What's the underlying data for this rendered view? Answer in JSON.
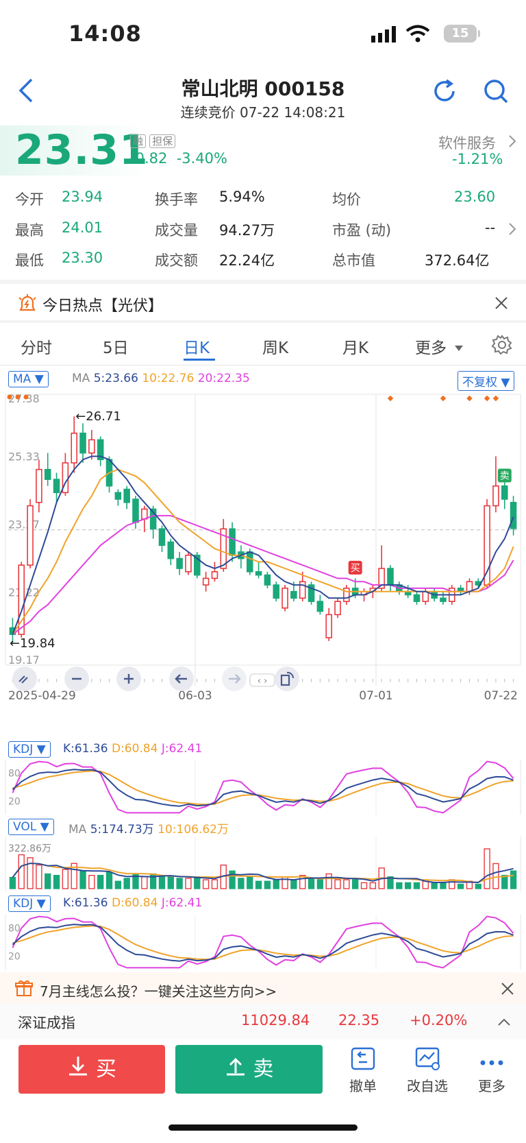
{
  "status": {
    "time": "14:08",
    "battery": "15"
  },
  "header": {
    "title": "常山北明 000158",
    "subtitle": "连续竞价 07-22 14:08:21"
  },
  "quote": {
    "price": "23.31",
    "tag_margin": "融",
    "tag_collateral": "担保",
    "change": "-0.82",
    "change_pct": "-3.40%",
    "sector_name": "软件服务",
    "sector_pct": "-1.21%"
  },
  "stats": {
    "open_label": "今开",
    "open": "23.94",
    "high_label": "最高",
    "high": "24.01",
    "low_label": "最低",
    "low": "23.30",
    "turnover_label": "换手率",
    "turnover": "5.94%",
    "volume_label": "成交量",
    "volume": "94.27万",
    "amount_label": "成交额",
    "amount": "22.24亿",
    "avg_label": "均价",
    "avg": "23.60",
    "pe_label": "市盈 (动)",
    "pe": "--",
    "mcap_label": "总市值",
    "mcap": "372.64亿"
  },
  "hot": {
    "text": "今日热点【光伏】"
  },
  "tabs": [
    "分时",
    "5日",
    "日K",
    "周K",
    "月K",
    "更多"
  ],
  "active_tab": "日K",
  "ma_bar": {
    "selector": "MA",
    "label": "MA",
    "ma5": "5:23.66",
    "ma10": "10:22.76",
    "ma20": "20:22.35",
    "adjust": "不复权"
  },
  "chart_data": {
    "type": "candlestick",
    "y_ticks": [
      "27.38",
      "25.33",
      "23.27",
      "21.22",
      "19.17"
    ],
    "x_ticks": [
      "2025-04-29",
      "06-03",
      "07-01",
      "07-22"
    ],
    "annotations": {
      "high": "26.71",
      "low": "19.84",
      "buy": "买",
      "sell": "卖"
    },
    "candles": [
      [
        20.3,
        20.6,
        19.84,
        20.1
      ],
      [
        20.1,
        22.3,
        20.0,
        22.2
      ],
      [
        22.2,
        24.2,
        22.1,
        24.0
      ],
      [
        24.1,
        25.4,
        23.8,
        25.1
      ],
      [
        25.1,
        25.6,
        24.6,
        24.8
      ],
      [
        24.8,
        25.0,
        24.1,
        24.4
      ],
      [
        24.4,
        25.6,
        24.3,
        25.3
      ],
      [
        25.3,
        26.71,
        25.0,
        26.2
      ],
      [
        26.2,
        26.5,
        25.3,
        25.6
      ],
      [
        25.6,
        26.3,
        25.4,
        26.0
      ],
      [
        26.0,
        26.1,
        25.2,
        25.4
      ],
      [
        25.4,
        25.5,
        24.4,
        24.6
      ],
      [
        24.4,
        24.5,
        24.0,
        24.2
      ],
      [
        24.5,
        24.6,
        23.9,
        24.1
      ],
      [
        24.2,
        24.3,
        23.3,
        23.5
      ],
      [
        23.6,
        24.0,
        23.2,
        23.9
      ],
      [
        23.9,
        24.0,
        23.0,
        23.3
      ],
      [
        23.3,
        23.4,
        22.6,
        22.8
      ],
      [
        22.9,
        23.0,
        22.2,
        22.4
      ],
      [
        22.4,
        22.6,
        21.9,
        22.1
      ],
      [
        22.0,
        22.6,
        21.9,
        22.5
      ],
      [
        22.5,
        22.6,
        21.8,
        21.9
      ],
      [
        21.6,
        22.0,
        21.4,
        21.8
      ],
      [
        21.8,
        22.3,
        21.7,
        22.0
      ],
      [
        22.1,
        23.6,
        22.0,
        23.3
      ],
      [
        23.3,
        23.5,
        22.3,
        22.5
      ],
      [
        22.6,
        22.8,
        22.1,
        22.4
      ],
      [
        22.6,
        22.7,
        21.9,
        22.0
      ],
      [
        22.0,
        22.3,
        21.8,
        21.9
      ],
      [
        21.9,
        22.0,
        21.5,
        21.6
      ],
      [
        21.6,
        21.7,
        21.1,
        21.2
      ],
      [
        20.9,
        21.6,
        20.8,
        21.5
      ],
      [
        21.4,
        21.7,
        21.1,
        21.2
      ],
      [
        21.2,
        22.0,
        21.1,
        21.7
      ],
      [
        21.6,
        21.7,
        21.0,
        21.1
      ],
      [
        21.1,
        21.3,
        20.7,
        20.8
      ],
      [
        20.0,
        20.9,
        19.9,
        20.7
      ],
      [
        20.7,
        21.2,
        20.6,
        21.1
      ],
      [
        21.1,
        21.6,
        21.0,
        21.5
      ],
      [
        21.5,
        21.8,
        21.2,
        21.3
      ],
      [
        21.3,
        21.5,
        21.1,
        21.4
      ],
      [
        21.4,
        21.6,
        21.2,
        21.5
      ],
      [
        21.5,
        22.8,
        21.4,
        22.1
      ],
      [
        22.1,
        22.2,
        21.4,
        21.6
      ],
      [
        21.6,
        21.7,
        21.3,
        21.4
      ],
      [
        21.4,
        21.6,
        21.2,
        21.3
      ],
      [
        21.3,
        21.4,
        21.0,
        21.1
      ],
      [
        21.1,
        21.5,
        21.0,
        21.4
      ],
      [
        21.4,
        21.5,
        21.1,
        21.2
      ],
      [
        21.2,
        21.4,
        21.0,
        21.1
      ],
      [
        21.1,
        21.6,
        21.0,
        21.5
      ],
      [
        21.5,
        21.6,
        21.3,
        21.4
      ],
      [
        21.4,
        21.8,
        21.3,
        21.7
      ],
      [
        21.7,
        21.8,
        21.5,
        21.6
      ],
      [
        21.6,
        24.2,
        21.5,
        24.0
      ],
      [
        24.0,
        25.5,
        23.8,
        24.6
      ],
      [
        24.6,
        24.8,
        23.9,
        24.2
      ],
      [
        24.1,
        24.3,
        23.1,
        23.31
      ]
    ],
    "ma5": [
      20.1,
      20.8,
      21.6,
      22.4,
      23.2,
      24.1,
      24.7,
      25.1,
      25.4,
      25.5,
      25.5,
      25.4,
      25.1,
      24.8,
      24.4,
      24.1,
      23.8,
      23.5,
      23.1,
      22.8,
      22.6,
      22.4,
      22.2,
      22.1,
      22.2,
      22.4,
      22.5,
      22.6,
      22.5,
      22.2,
      21.9,
      21.7,
      21.6,
      21.6,
      21.5,
      21.4,
      21.2,
      21.2,
      21.2,
      21.3,
      21.3,
      21.4,
      21.6,
      21.6,
      21.6,
      21.5,
      21.4,
      21.4,
      21.3,
      21.3,
      21.3,
      21.3,
      21.4,
      21.5,
      22.0,
      22.6,
      23.0,
      23.66
    ],
    "ma10": [
      20.1,
      20.5,
      20.9,
      21.4,
      21.8,
      22.3,
      22.9,
      23.4,
      23.9,
      24.3,
      24.8,
      25.0,
      25.1,
      25.0,
      24.9,
      24.7,
      24.4,
      24.1,
      23.8,
      23.5,
      23.3,
      23.1,
      22.9,
      22.7,
      22.6,
      22.5,
      22.5,
      22.4,
      22.3,
      22.3,
      22.2,
      22.1,
      22.0,
      21.9,
      21.8,
      21.7,
      21.6,
      21.5,
      21.4,
      21.4,
      21.4,
      21.4,
      21.4,
      21.4,
      21.4,
      21.4,
      21.4,
      21.4,
      21.4,
      21.4,
      21.4,
      21.4,
      21.4,
      21.4,
      21.6,
      21.8,
      22.1,
      22.76
    ],
    "ma20": [
      20.1,
      20.3,
      20.5,
      20.8,
      21.0,
      21.3,
      21.6,
      21.9,
      22.2,
      22.5,
      22.8,
      23.0,
      23.2,
      23.4,
      23.5,
      23.6,
      23.7,
      23.7,
      23.7,
      23.6,
      23.5,
      23.4,
      23.3,
      23.2,
      23.1,
      23.0,
      22.9,
      22.8,
      22.7,
      22.6,
      22.5,
      22.4,
      22.3,
      22.2,
      22.1,
      22.0,
      21.9,
      21.8,
      21.8,
      21.7,
      21.7,
      21.6,
      21.6,
      21.6,
      21.5,
      21.5,
      21.5,
      21.5,
      21.5,
      21.5,
      21.4,
      21.4,
      21.4,
      21.4,
      21.5,
      21.7,
      21.9,
      22.35
    ]
  },
  "kdj1": {
    "label": "KDJ",
    "k": "K:61.36",
    "d": "D:60.84",
    "j": "J:62.41",
    "t80": "80",
    "t20": "20"
  },
  "vol": {
    "label": "VOL",
    "ma": "MA",
    "ma5": "5:174.73万",
    "ma10": "10:106.62万",
    "max": "322.86万"
  },
  "kdj2": {
    "label": "KDJ",
    "k": "K:61.36",
    "d": "D:60.84",
    "j": "J:62.41",
    "t80": "80",
    "t20": "20"
  },
  "banner": {
    "text": "7月主线怎么投？一键关注这些方向>>"
  },
  "index": {
    "name": "深证成指",
    "value": "11029.84",
    "change": "22.35",
    "pct": "+0.20%"
  },
  "bottom": {
    "buy": "买",
    "sell": "卖",
    "cancel": "撤单",
    "watch": "改自选",
    "more": "更多"
  },
  "colors": {
    "up": "#e8383d",
    "down": "#1aa87a",
    "ma5": "#2c4a96",
    "ma10": "#f0a32a",
    "ma20": "#e040e0",
    "accent": "#2a6fd6"
  }
}
